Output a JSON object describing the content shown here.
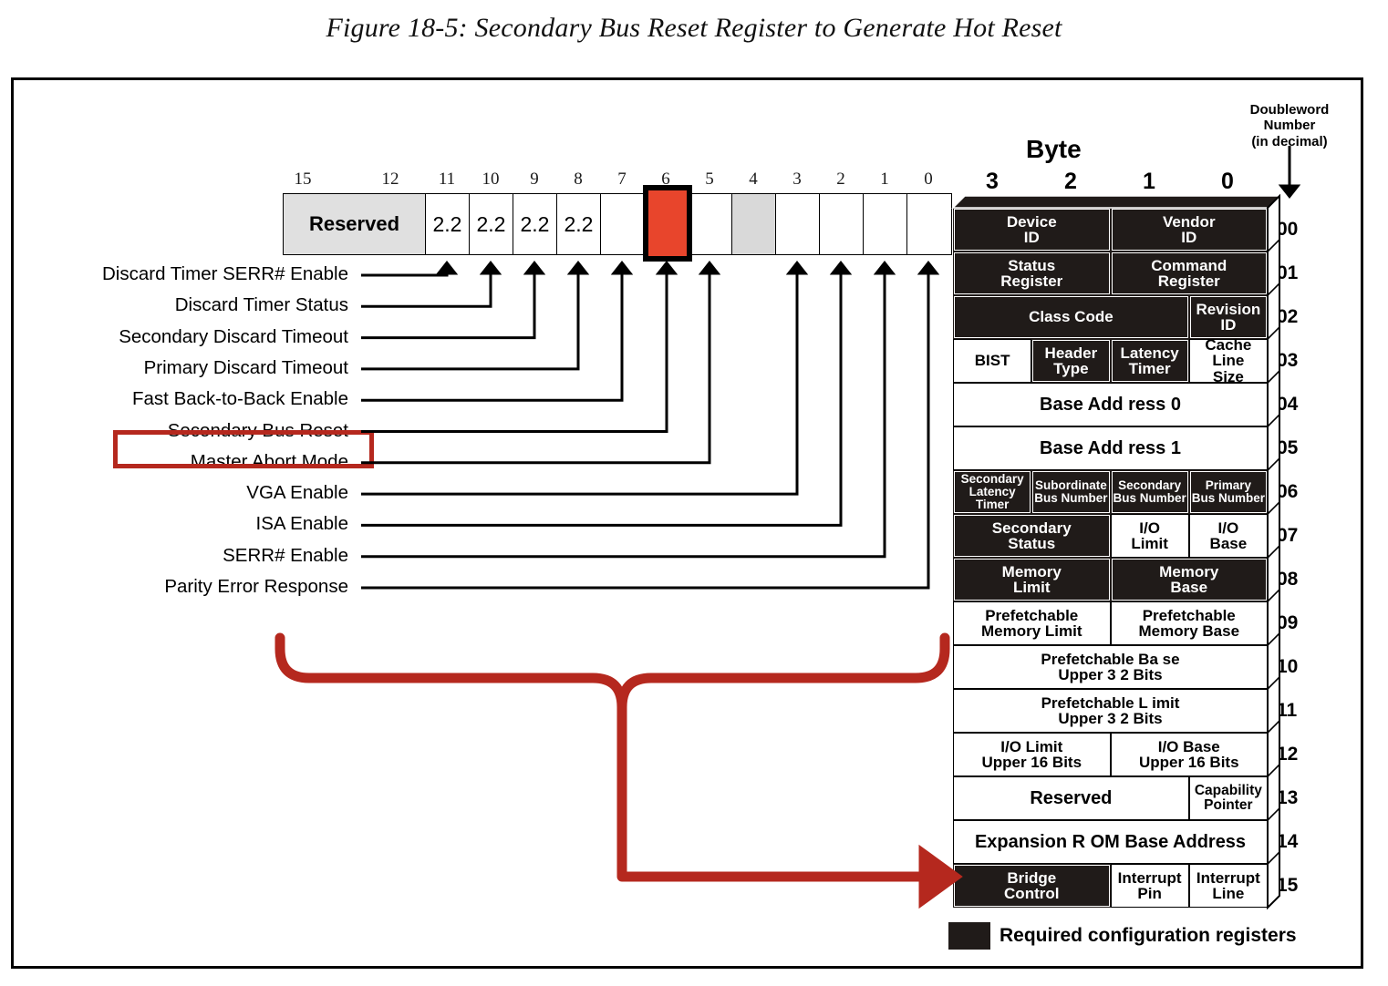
{
  "caption": "Figure 18-5: Secondary Bus Reset Register to Generate Hot Reset",
  "colors": {
    "highlight_red": "#e8452c",
    "annotation_red": "#b5281e",
    "register_black": "#201b19",
    "reserved_gray": "#e0e0e0"
  },
  "bit_register": {
    "bit_numbers": [
      "15",
      "12",
      "11",
      "10",
      "9",
      "8",
      "7",
      "6",
      "5",
      "4",
      "3",
      "2",
      "1",
      "0"
    ],
    "cells": [
      {
        "label": "Reserved",
        "style": "reserved"
      },
      {
        "label": "2.2",
        "style": "v22"
      },
      {
        "label": "2.2",
        "style": "v22"
      },
      {
        "label": "2.2",
        "style": "v22"
      },
      {
        "label": "2.2",
        "style": "v22"
      },
      {
        "label": "",
        "style": "plain"
      },
      {
        "label": "",
        "style": "red"
      },
      {
        "label": "",
        "style": "plain"
      },
      {
        "label": "",
        "style": "gray"
      },
      {
        "label": "",
        "style": "plain"
      },
      {
        "label": "",
        "style": "plain"
      },
      {
        "label": "",
        "style": "plain"
      },
      {
        "label": "",
        "style": "plain"
      }
    ]
  },
  "bit_labels": [
    {
      "text": "Discard Timer SERR# Enable",
      "bit": "11"
    },
    {
      "text": "Discard Timer Status",
      "bit": "10"
    },
    {
      "text": "Secondary Discard Timeout",
      "bit": "9"
    },
    {
      "text": "Primary Discard Timeout",
      "bit": "8"
    },
    {
      "text": "Fast Back-to-Back Enable",
      "bit": "7"
    },
    {
      "text": "Secondary Bus Reset",
      "bit": "6",
      "highlighted": true
    },
    {
      "text": "Master Abort Mode",
      "bit": "5"
    },
    {
      "text": "VGA Enable",
      "bit": "3"
    },
    {
      "text": "ISA Enable",
      "bit": "2"
    },
    {
      "text": "SERR# Enable",
      "bit": "1"
    },
    {
      "text": "Parity Error Response",
      "bit": "0"
    }
  ],
  "headers": {
    "byte": "Byte",
    "byte_numbers": [
      "3",
      "2",
      "1",
      "0"
    ],
    "doubleword": "Doubleword\nNumber\n(in decimal)",
    "doubleword_line1": "Doubleword",
    "doubleword_line2": "Number",
    "doubleword_line3": "(in decimal)"
  },
  "config_space": {
    "dword_numbers": [
      "00",
      "01",
      "02",
      "03",
      "04",
      "05",
      "06",
      "07",
      "08",
      "09",
      "10",
      "11",
      "12",
      "13",
      "14",
      "15"
    ],
    "rows": [
      {
        "dword": "00",
        "cells": [
          {
            "label": "Device\nID",
            "w": "w50",
            "fill": "blk"
          },
          {
            "label": "Vendor\nID",
            "w": "w50",
            "fill": "blk"
          }
        ]
      },
      {
        "dword": "01",
        "cells": [
          {
            "label": "Status\nRegister",
            "w": "w50",
            "fill": "blk"
          },
          {
            "label": "Command\nRegister",
            "w": "w50",
            "fill": "blk"
          }
        ]
      },
      {
        "dword": "02",
        "cells": [
          {
            "label": "Class Code",
            "w": "w75",
            "fill": "blk"
          },
          {
            "label": "Revision\nID",
            "w": "w25",
            "fill": "blk"
          }
        ]
      },
      {
        "dword": "03",
        "cells": [
          {
            "label": "BIST",
            "w": "w25",
            "fill": "wht"
          },
          {
            "label": "Header\nType",
            "w": "w25",
            "fill": "blk"
          },
          {
            "label": "Latency\nTimer",
            "w": "w25",
            "fill": "blk"
          },
          {
            "label": "Cache\nLine\nSize",
            "w": "w25",
            "fill": "wht"
          }
        ]
      },
      {
        "dword": "04",
        "cells": [
          {
            "label": "Base Add ress  0",
            "w": "w100",
            "fill": "wht",
            "size": "lg"
          }
        ]
      },
      {
        "dword": "05",
        "cells": [
          {
            "label": "Base Add ress  1",
            "w": "w100",
            "fill": "wht",
            "size": "lg"
          }
        ]
      },
      {
        "dword": "06",
        "cells": [
          {
            "label": "Secondary\nLatency Timer",
            "w": "w25",
            "fill": "blk",
            "size": "sm"
          },
          {
            "label": "Subordinate\nBus Number",
            "w": "w25",
            "fill": "blk",
            "size": "sm"
          },
          {
            "label": "Secondary\nBus Number",
            "w": "w25",
            "fill": "blk",
            "size": "sm"
          },
          {
            "label": "Primary\nBus Number",
            "w": "w25",
            "fill": "blk",
            "size": "sm"
          }
        ]
      },
      {
        "dword": "07",
        "cells": [
          {
            "label": "Secondary\nStatus",
            "w": "w50",
            "fill": "blk"
          },
          {
            "label": "I/O\nLimit",
            "w": "w25",
            "fill": "wht"
          },
          {
            "label": "I/O\nBase",
            "w": "w25",
            "fill": "wht"
          }
        ]
      },
      {
        "dword": "08",
        "cells": [
          {
            "label": "Memory\nLimit",
            "w": "w50",
            "fill": "blk"
          },
          {
            "label": "Memory\nBase",
            "w": "w50",
            "fill": "blk"
          }
        ]
      },
      {
        "dword": "09",
        "cells": [
          {
            "label": "Prefetchable\nMemory Limit",
            "w": "w50",
            "fill": "wht"
          },
          {
            "label": "Prefetchable\nMemory Base",
            "w": "w50",
            "fill": "wht"
          }
        ]
      },
      {
        "dword": "10",
        "cells": [
          {
            "label": "Prefetchable Ba se\nUpper 3 2  Bits",
            "w": "w100",
            "fill": "wht"
          }
        ]
      },
      {
        "dword": "11",
        "cells": [
          {
            "label": "Prefetchable L imit\nUpper 3 2  Bits",
            "w": "w100",
            "fill": "wht"
          }
        ]
      },
      {
        "dword": "12",
        "cells": [
          {
            "label": "I/O Limit\nUpper 16 Bits",
            "w": "w50",
            "fill": "wht"
          },
          {
            "label": "I/O Base\nUpper 16 Bits",
            "w": "w50",
            "fill": "wht"
          }
        ]
      },
      {
        "dword": "13",
        "cells": [
          {
            "label": "Reserved",
            "w": "w75",
            "fill": "wht",
            "size": "lg"
          },
          {
            "label": "Capability\nPointer",
            "w": "w25",
            "fill": "wht",
            "size": "md"
          }
        ]
      },
      {
        "dword": "14",
        "cells": [
          {
            "label": "Expansion R OM  Base  Address",
            "w": "w100",
            "fill": "wht",
            "size": "lg"
          }
        ]
      },
      {
        "dword": "15",
        "cells": [
          {
            "label": "Bridge\nControl",
            "w": "w50",
            "fill": "blk"
          },
          {
            "label": "Interrupt\nPin",
            "w": "w25",
            "fill": "wht"
          },
          {
            "label": "Interrupt\nLine",
            "w": "w25",
            "fill": "wht"
          }
        ]
      }
    ]
  },
  "legend": {
    "text": "Required configuration registers"
  }
}
